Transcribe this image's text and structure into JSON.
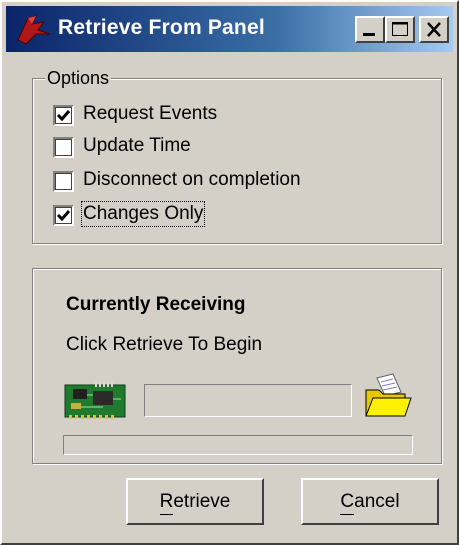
{
  "window": {
    "title": "Retrieve From Panel",
    "controls": {
      "minimize": "minimize-icon",
      "maximize": "maximize-icon",
      "close": "close-icon"
    }
  },
  "options": {
    "legend": "Options",
    "items": [
      {
        "label": "Request Events",
        "checked": true
      },
      {
        "label": "Update Time",
        "checked": false
      },
      {
        "label": "Disconnect on completion",
        "checked": false
      },
      {
        "label": "Changes Only",
        "checked": true
      }
    ]
  },
  "progress": {
    "heading": "Currently Receiving",
    "status": "Click Retrieve To Begin",
    "source_icon": "circuit-board-icon",
    "destination_icon": "open-folder-icon",
    "fraction": 0
  },
  "buttons": {
    "retrieve": {
      "label": "Retrieve",
      "accelerator": "R"
    },
    "cancel": {
      "label": "Cancel",
      "accelerator": "C"
    }
  },
  "colors": {
    "title_bar_start": "#0a246a",
    "title_bar_end": "#a6caf0",
    "face": "#d4d0c8"
  }
}
